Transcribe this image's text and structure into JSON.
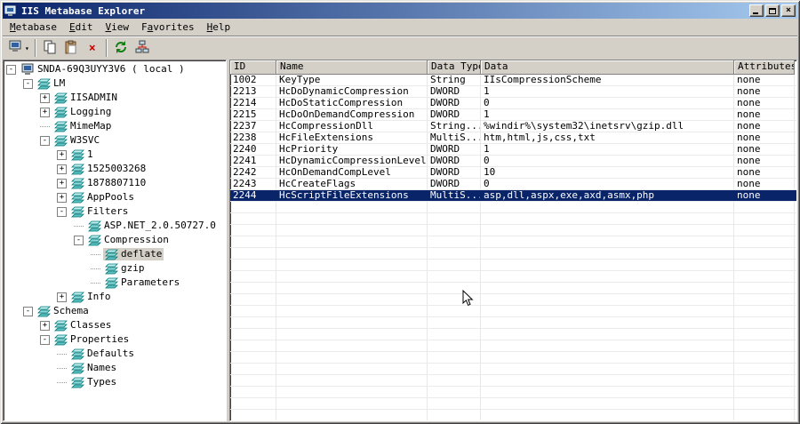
{
  "window": {
    "title": "IIS Metabase Explorer"
  },
  "menu": {
    "items": [
      {
        "label": "Metabase",
        "underline": 0
      },
      {
        "label": "Edit",
        "underline": 0
      },
      {
        "label": "View",
        "underline": 0
      },
      {
        "label": "Favorites",
        "underline": 1
      },
      {
        "label": "Help",
        "underline": 0
      }
    ]
  },
  "toolbar": {
    "buttons": [
      "connect",
      "copy",
      "paste",
      "delete",
      "refresh",
      "network"
    ]
  },
  "tree": {
    "items": [
      {
        "label": "SNDA-69Q3UYY3V6 ( local )",
        "depth": 0,
        "expander": "-",
        "icon": "computer",
        "selected": false
      },
      {
        "label": "LM",
        "depth": 1,
        "expander": "-",
        "icon": "node",
        "selected": false
      },
      {
        "label": "IISADMIN",
        "depth": 2,
        "expander": "+",
        "icon": "node",
        "selected": false
      },
      {
        "label": "Logging",
        "depth": 2,
        "expander": "+",
        "icon": "node",
        "selected": false
      },
      {
        "label": "MimeMap",
        "depth": 2,
        "expander": "",
        "icon": "node",
        "selected": false
      },
      {
        "label": "W3SVC",
        "depth": 2,
        "expander": "-",
        "icon": "node",
        "selected": false
      },
      {
        "label": "1",
        "depth": 3,
        "expander": "+",
        "icon": "node",
        "selected": false
      },
      {
        "label": "1525003268",
        "depth": 3,
        "expander": "+",
        "icon": "node",
        "selected": false
      },
      {
        "label": "1878807110",
        "depth": 3,
        "expander": "+",
        "icon": "node",
        "selected": false
      },
      {
        "label": "AppPools",
        "depth": 3,
        "expander": "+",
        "icon": "node",
        "selected": false
      },
      {
        "label": "Filters",
        "depth": 3,
        "expander": "-",
        "icon": "node",
        "selected": false
      },
      {
        "label": "ASP.NET_2.0.50727.0",
        "depth": 4,
        "expander": "",
        "icon": "node",
        "selected": false
      },
      {
        "label": "Compression",
        "depth": 4,
        "expander": "-",
        "icon": "node",
        "selected": false
      },
      {
        "label": "deflate",
        "depth": 5,
        "expander": "",
        "icon": "node",
        "selected": true
      },
      {
        "label": "gzip",
        "depth": 5,
        "expander": "",
        "icon": "node",
        "selected": false
      },
      {
        "label": "Parameters",
        "depth": 5,
        "expander": "",
        "icon": "node",
        "selected": false
      },
      {
        "label": "Info",
        "depth": 3,
        "expander": "+",
        "icon": "node",
        "selected": false
      },
      {
        "label": "Schema",
        "depth": 1,
        "expander": "-",
        "icon": "node",
        "selected": false
      },
      {
        "label": "Classes",
        "depth": 2,
        "expander": "+",
        "icon": "node",
        "selected": false
      },
      {
        "label": "Properties",
        "depth": 2,
        "expander": "-",
        "icon": "node",
        "selected": false
      },
      {
        "label": "Defaults",
        "depth": 3,
        "expander": "",
        "icon": "node",
        "selected": false
      },
      {
        "label": "Names",
        "depth": 3,
        "expander": "",
        "icon": "node",
        "selected": false
      },
      {
        "label": "Types",
        "depth": 3,
        "expander": "",
        "icon": "node",
        "selected": false
      }
    ]
  },
  "table": {
    "columns": [
      "ID",
      "Name",
      "Data Type",
      "Data",
      "Attributes"
    ],
    "rows": [
      {
        "cells": [
          "1002",
          "KeyType",
          "String",
          "IIsCompressionScheme",
          "none"
        ],
        "selected": false
      },
      {
        "cells": [
          "2213",
          "HcDoDynamicCompression",
          "DWORD",
          "1",
          "none"
        ],
        "selected": false
      },
      {
        "cells": [
          "2214",
          "HcDoStaticCompression",
          "DWORD",
          "0",
          "none"
        ],
        "selected": false
      },
      {
        "cells": [
          "2215",
          "HcDoOnDemandCompression",
          "DWORD",
          "1",
          "none"
        ],
        "selected": false
      },
      {
        "cells": [
          "2237",
          "HcCompressionDll",
          "String...",
          "%windir%\\system32\\inetsrv\\gzip.dll",
          "none"
        ],
        "selected": false
      },
      {
        "cells": [
          "2238",
          "HcFileExtensions",
          "MultiS...",
          "htm,html,js,css,txt",
          "none"
        ],
        "selected": false
      },
      {
        "cells": [
          "2240",
          "HcPriority",
          "DWORD",
          "1",
          "none"
        ],
        "selected": false
      },
      {
        "cells": [
          "2241",
          "HcDynamicCompressionLevel",
          "DWORD",
          "0",
          "none"
        ],
        "selected": false
      },
      {
        "cells": [
          "2242",
          "HcOnDemandCompLevel",
          "DWORD",
          "10",
          "none"
        ],
        "selected": false
      },
      {
        "cells": [
          "2243",
          "HcCreateFlags",
          "DWORD",
          "0",
          "none"
        ],
        "selected": false
      },
      {
        "cells": [
          "2244",
          "HcScriptFileExtensions",
          "MultiS...",
          "asp,dll,aspx,exe,axd,asmx,php",
          "none"
        ],
        "selected": true
      }
    ]
  },
  "colors": {
    "titlebar_start": "#0A246A",
    "titlebar_end": "#A6CAF0",
    "selection": "#0A246A",
    "face": "#D4D0C8",
    "tree_inactive_selection": "#D4D0C8"
  }
}
